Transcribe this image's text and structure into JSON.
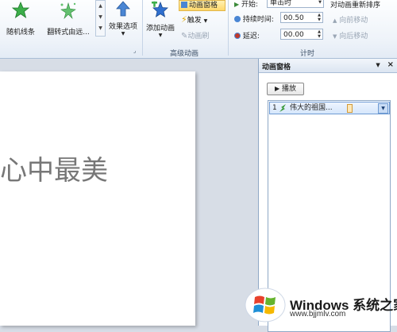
{
  "ribbon": {
    "random_lines": "随机线条",
    "flip": "翻转式由远...",
    "effect_options": "效果选项",
    "add_animation": "添加动画",
    "animation_pane": "动画窗格",
    "trigger": "触发",
    "animation_painter": "动画刷",
    "advanced_group": "高级动画",
    "start_label": "开始:",
    "start_value": "单击时",
    "duration_label": "持续时间:",
    "duration_value": "00.50",
    "delay_label": "延迟:",
    "delay_value": "00.00",
    "timing_group": "计时",
    "reorder_title": "对动画重新排序",
    "move_earlier": "向前移动",
    "move_later": "向后移动"
  },
  "slide": {
    "text": "心中最美"
  },
  "pane": {
    "title": "动画窗格",
    "close": "×",
    "dropdown": "▼",
    "play": "播放",
    "item_number": "1",
    "item_name": "伟大的祖国..."
  },
  "watermark": {
    "line1": "Windows 系统之家",
    "line2": "www.bjjmlv.com"
  },
  "colors": {
    "ribbon_bg": "#eef3f9",
    "pane_header": "#dbe5f1",
    "highlight": "#ffd86a",
    "slide_text": "#777777"
  }
}
